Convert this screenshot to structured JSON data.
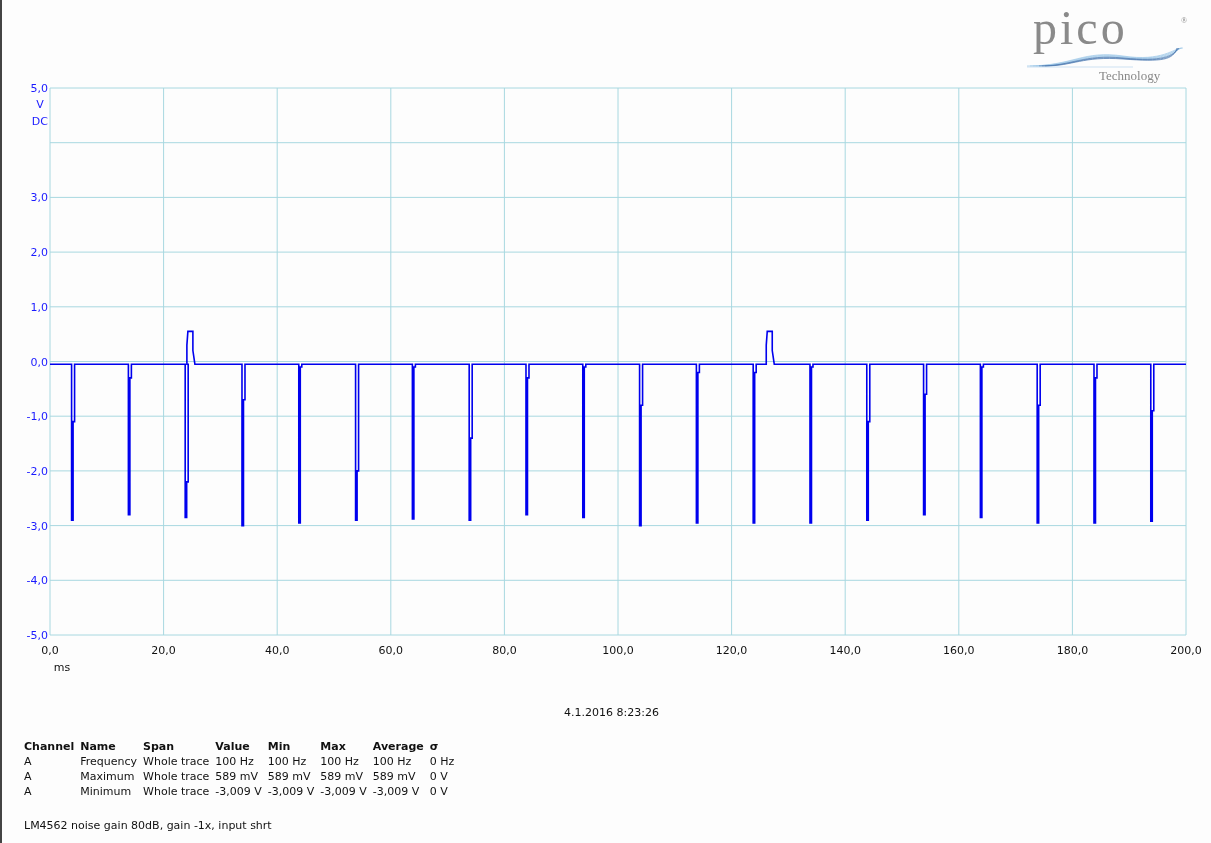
{
  "logo": {
    "name": "pico",
    "registered": "®",
    "subtitle": "Technology"
  },
  "plot": {
    "y_labels": [
      "5,0",
      "3,0",
      "2,0",
      "1,0",
      "0,0",
      "-1,0",
      "-2,0",
      "-3,0",
      "-4,0",
      "-5,0"
    ],
    "y_unit": "V",
    "coupling": "DC",
    "x_labels": [
      "0,0",
      "20,0",
      "40,0",
      "60,0",
      "80,0",
      "100,0",
      "120,0",
      "140,0",
      "160,0",
      "180,0",
      "200,0"
    ],
    "x_unit": "ms"
  },
  "timestamp": "4.1.2016 8:23:26",
  "measurements": {
    "columns": [
      "Channel",
      "Name",
      "Span",
      "Value",
      "Min",
      "Max",
      "Average",
      "σ"
    ],
    "rows": [
      [
        "A",
        "Frequency",
        "Whole trace",
        "100 Hz",
        "100 Hz",
        "100 Hz",
        "100 Hz",
        "0 Hz"
      ],
      [
        "A",
        "Maximum",
        "Whole trace",
        "589 mV",
        "589 mV",
        "589 mV",
        "589 mV",
        "0 V"
      ],
      [
        "A",
        "Minimum",
        "Whole trace",
        "-3,009 V",
        "-3,009 V",
        "-3,009 V",
        "-3,009 V",
        "0 V"
      ]
    ]
  },
  "note": "LM4562 noise gain 80dB, gain -1x, input shrt"
}
